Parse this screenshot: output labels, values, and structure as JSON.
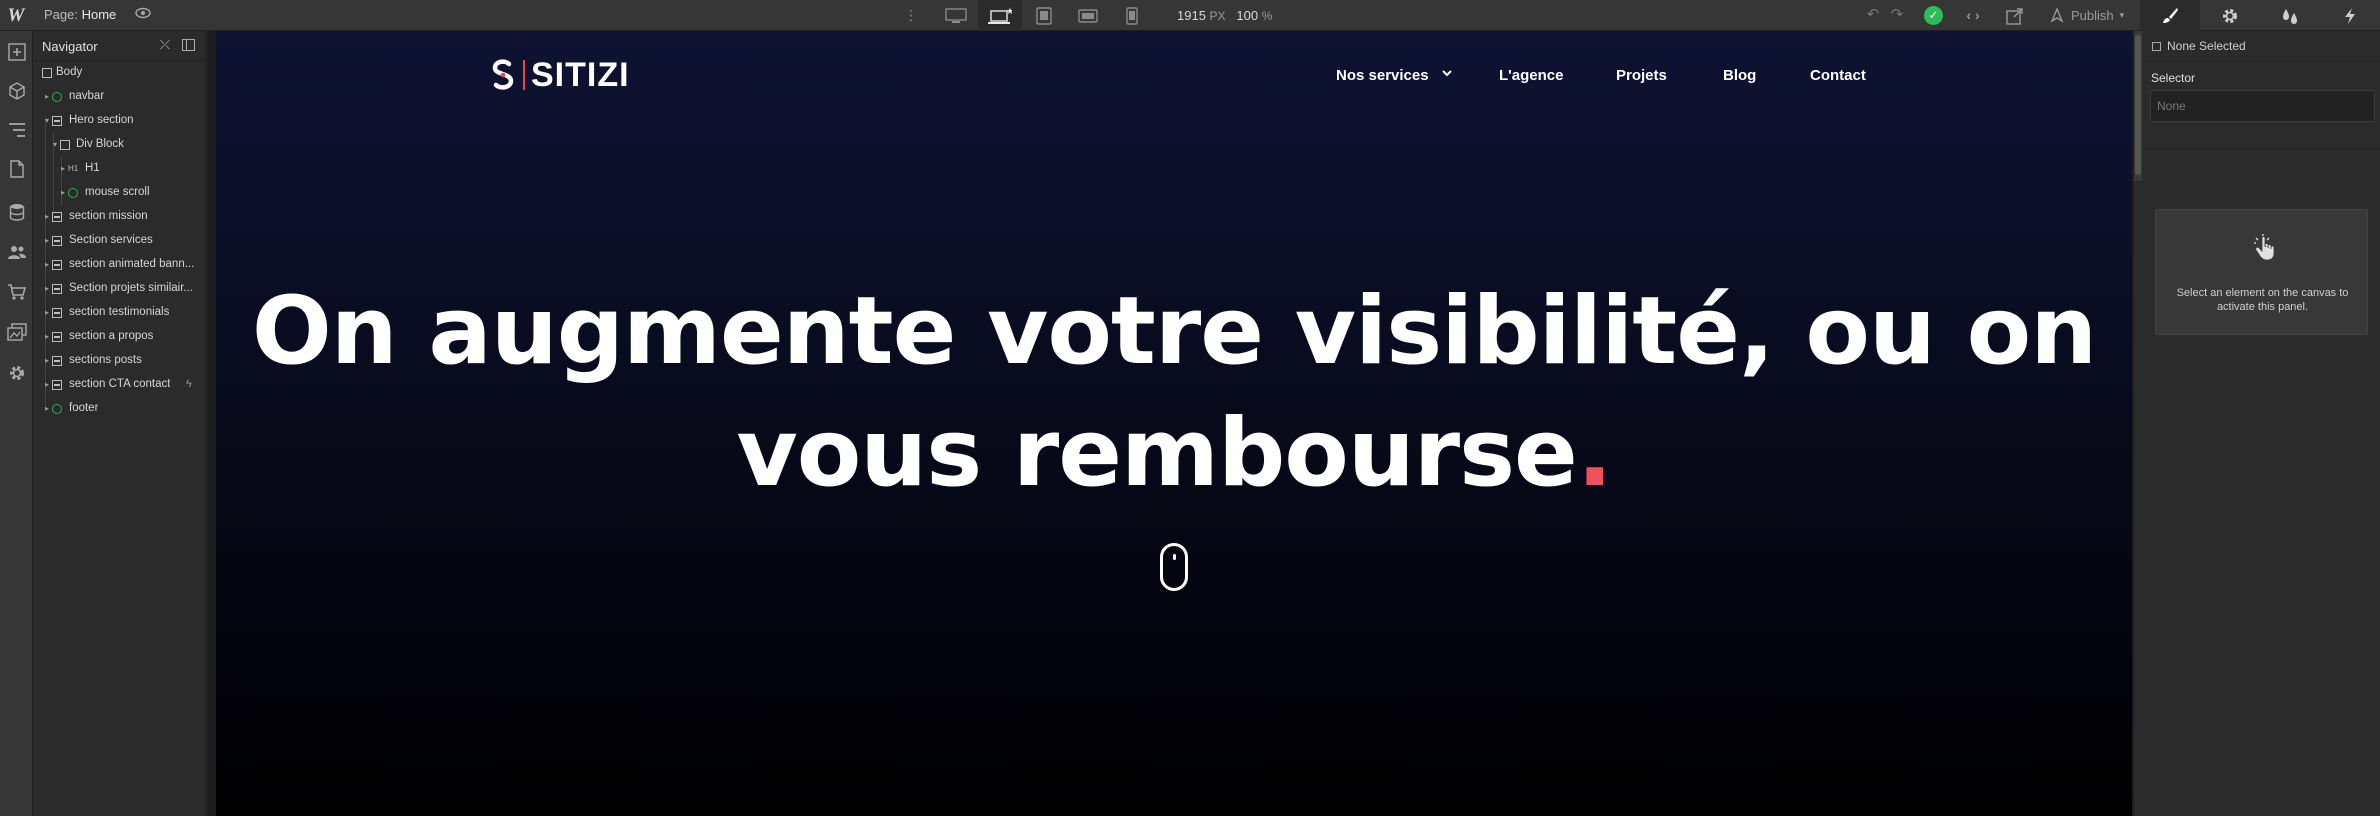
{
  "topbar": {
    "app_logo": "W",
    "page_prefix": "Page:",
    "page_name": "Home",
    "width_value": "1915",
    "width_unit": "PX",
    "zoom_value": "100",
    "zoom_unit": "%",
    "publish_label": "Publish",
    "icons": [
      "eye-icon",
      "kebab-icon",
      "desktop-icon",
      "laptop-base-icon",
      "tablet-icon",
      "mobile-landscape-icon",
      "mobile-portrait-icon",
      "undo-icon",
      "redo-icon",
      "check-icon",
      "code-icon",
      "export-icon",
      "publish-icon",
      "brush-icon",
      "gear-icon",
      "drops-icon",
      "bolt-icon"
    ]
  },
  "rail": {
    "icons": [
      "add-icon",
      "components-icon",
      "navigator-icon",
      "pages-icon",
      "cms-icon",
      "users-icon",
      "ecommerce-icon",
      "assets-icon",
      "settings-icon"
    ]
  },
  "navigator": {
    "title": "Navigator",
    "tree": [
      {
        "label": "Body"
      },
      {
        "label": "navbar"
      },
      {
        "label": "Hero section"
      },
      {
        "label": "Div Block"
      },
      {
        "label": "H1",
        "tag": "H1"
      },
      {
        "label": "mouse scroll"
      },
      {
        "label": "section mission"
      },
      {
        "label": "Section services"
      },
      {
        "label": "section animated bann..."
      },
      {
        "label": "Section projets similair..."
      },
      {
        "label": "section testimonials"
      },
      {
        "label": "section a propos"
      },
      {
        "label": "sections posts"
      },
      {
        "label": "section CTA contact"
      },
      {
        "label": "footer"
      }
    ]
  },
  "site": {
    "brand": "SITIZI",
    "nav": [
      "Nos services",
      "L'agence",
      "Projets",
      "Blog",
      "Contact"
    ],
    "hero_line1": "On augmente votre visibilité, ou on",
    "hero_line2": "vous rembourse",
    "hero_dot": ".",
    "accent_color": "#f0505a"
  },
  "style_panel": {
    "none_selected": "None Selected",
    "selector_label": "Selector",
    "selector_placeholder": "None",
    "empty_message": "Select an element on the canvas to activate this panel."
  }
}
